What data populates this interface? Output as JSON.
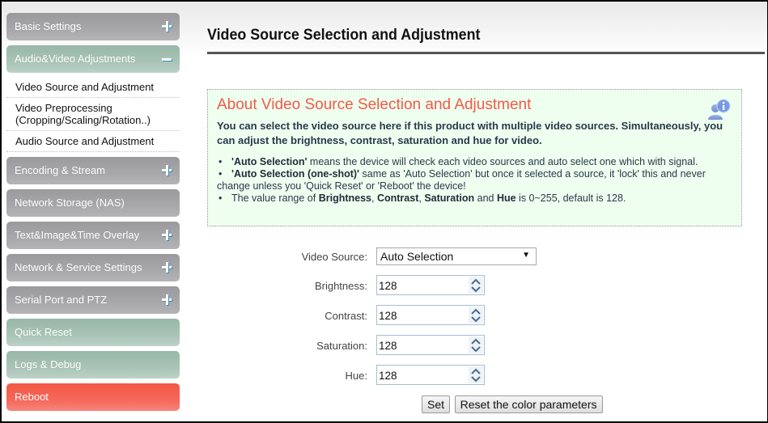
{
  "sidebar": {
    "sections": [
      {
        "label": "Basic Settings",
        "toggle": "plus"
      },
      {
        "label": "Audio&Video Adjustments",
        "toggle": "minus"
      },
      {
        "label": "Encoding & Stream",
        "toggle": "plus"
      },
      {
        "label": "Network Storage (NAS)",
        "toggle": "none"
      },
      {
        "label": "Text&Image&Time Overlay",
        "toggle": "plus"
      },
      {
        "label": "Network & Service Settings",
        "toggle": "plus"
      },
      {
        "label": "Serial Port and PTZ",
        "toggle": "plus"
      },
      {
        "label": "Quick Reset",
        "toggle": "none"
      },
      {
        "label": "Logs & Debug",
        "toggle": "none"
      },
      {
        "label": "Reboot",
        "toggle": "none"
      }
    ],
    "submenu": [
      {
        "label": "Video Source and Adjustment"
      },
      {
        "label_line1": "Video Preprocessing",
        "label_line2": "(Cropping/Scaling/Rotation..)"
      },
      {
        "label": "Audio Source and Adjustment"
      }
    ]
  },
  "main": {
    "title": "Video Source Selection and Adjustment",
    "info": {
      "title": "About Video Source Selection and Adjustment",
      "icon": "user-info-icon",
      "lead": "You can select the video source here if this product with multiple video sources. Simultaneously, you can adjust the brightness, contrast, saturation and hue for video.",
      "bullets": [
        {
          "bold": "'Auto Selection'",
          "text": " means the device will check each video sources and auto select one which with signal."
        },
        {
          "bold": "'Auto Selection (one-shot)'",
          "text": " same as 'Auto Selection' but once it selected a source, it 'lock' this and never change unless you 'Quick Reset' or 'Reboot' the device!"
        },
        {
          "pre": "The value range of ",
          "b1": "Brightness",
          "s1": ", ",
          "b2": "Contrast",
          "s2": ", ",
          "b3": "Saturation",
          "s3": " and ",
          "b4": "Hue",
          "post": " is 0~255, default is 128."
        }
      ]
    },
    "form": {
      "video_source": {
        "label": "Video Source:",
        "value": "Auto Selection"
      },
      "brightness": {
        "label": "Brightness:",
        "value": "128"
      },
      "contrast": {
        "label": "Contrast:",
        "value": "128"
      },
      "saturation": {
        "label": "Saturation:",
        "value": "128"
      },
      "hue": {
        "label": "Hue:",
        "value": "128"
      },
      "set_label": "Set",
      "reset_label": "Reset the color parameters"
    }
  },
  "colors": {
    "menu_gray": "#a8a8aa",
    "menu_green": "#a9c4b6",
    "menu_red": "#f5685a",
    "info_title": "#f05a4a",
    "info_bg": "#efffef"
  }
}
